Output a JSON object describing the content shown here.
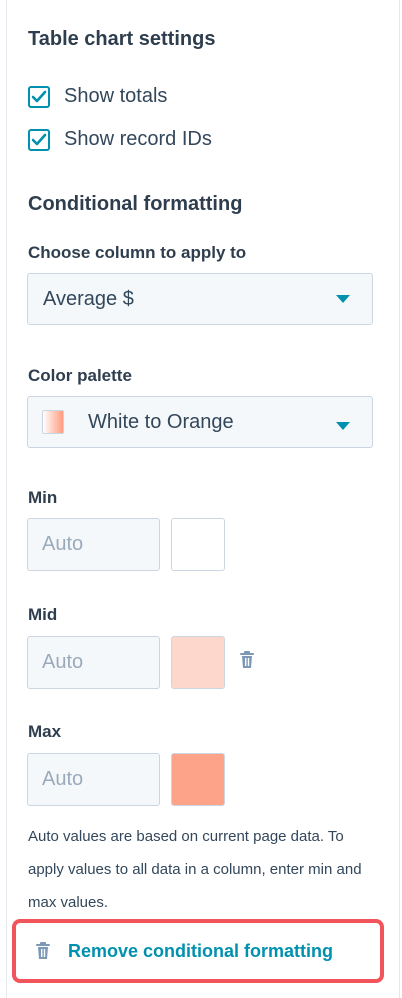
{
  "table_settings": {
    "title": "Table chart settings",
    "show_totals": {
      "label": "Show totals",
      "checked": true
    },
    "show_record_ids": {
      "label": "Show record IDs",
      "checked": true
    }
  },
  "conditional": {
    "title": "Conditional formatting",
    "column_label": "Choose column to apply to",
    "column_value": "Average $",
    "palette_label": "Color palette",
    "palette_value": "White to Orange",
    "min": {
      "label": "Min",
      "placeholder": "Auto",
      "color": "#ffffff"
    },
    "mid": {
      "label": "Mid",
      "placeholder": "Auto",
      "color": "#fdd6cc"
    },
    "max": {
      "label": "Max",
      "placeholder": "Auto",
      "color": "#fda38a"
    },
    "help_text": "Auto values are based on current page data. To apply values to all data in a column, enter min and max values.",
    "remove_label": "Remove conditional formatting"
  },
  "colors": {
    "accent": "#0091ae",
    "highlight": "#f2545b"
  }
}
